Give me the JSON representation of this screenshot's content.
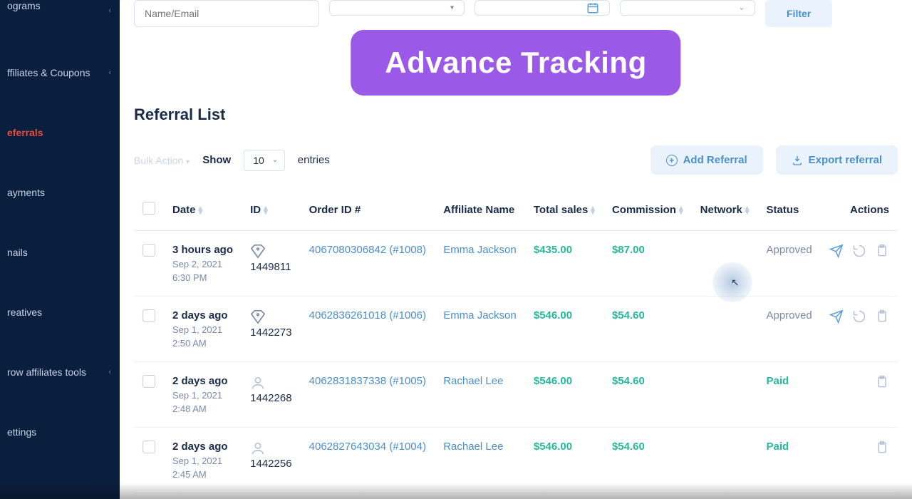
{
  "sidebar": {
    "items": [
      {
        "label": "ograms",
        "has_chevron": true
      },
      {
        "label": "ffiliates & Coupons",
        "has_chevron": true
      },
      {
        "label": "eferrals",
        "active": true
      },
      {
        "label": "ayments"
      },
      {
        "label": "nails"
      },
      {
        "label": "reatives"
      },
      {
        "label": "row affiliates tools",
        "has_chevron": true
      },
      {
        "label": "ettings"
      }
    ]
  },
  "filters": {
    "name_placeholder": "Name/Email",
    "filter_btn": "Filter"
  },
  "overlay": {
    "title": "Advance Tracking"
  },
  "section": {
    "title": "Referral List"
  },
  "toolbar": {
    "bulk_action": "Bulk Action",
    "show_label": "Show",
    "show_value": "10",
    "entries_label": "entries",
    "add_label": "Add Referral",
    "export_label": "Export referral"
  },
  "columns": [
    "Date",
    "ID",
    "Order ID #",
    "Affiliate Name",
    "Total sales",
    "Commission",
    "Network",
    "Status",
    "Actions"
  ],
  "rows": [
    {
      "date_rel": "3 hours ago",
      "date_abs1": "Sep 2, 2021",
      "date_abs2": "6:30 PM",
      "icon": "tag",
      "id": "1449811",
      "order": "4067080306842 (#1008)",
      "affiliate": "Emma Jackson",
      "sales": "$435.00",
      "commission": "$87.00",
      "network": "",
      "status": "Approved",
      "status_class": "approved",
      "actions": [
        "send",
        "undo",
        "clip"
      ]
    },
    {
      "date_rel": "2 days ago",
      "date_abs1": "Sep 1, 2021",
      "date_abs2": "2:50 AM",
      "icon": "tag",
      "id": "1442273",
      "order": "4062836261018 (#1006)",
      "affiliate": "Emma Jackson",
      "sales": "$546.00",
      "commission": "$54.60",
      "network": "",
      "status": "Approved",
      "status_class": "approved",
      "actions": [
        "send",
        "undo",
        "clip"
      ]
    },
    {
      "date_rel": "2 days ago",
      "date_abs1": "Sep 1, 2021",
      "date_abs2": "2:48 AM",
      "icon": "user",
      "id": "1442268",
      "order": "4062831837338 (#1005)",
      "affiliate": "Rachael Lee",
      "sales": "$546.00",
      "commission": "$54.60",
      "network": "",
      "status": "Paid",
      "status_class": "paid",
      "actions": [
        "clip"
      ]
    },
    {
      "date_rel": "2 days ago",
      "date_abs1": "Sep 1, 2021",
      "date_abs2": "2:45 AM",
      "icon": "user",
      "id": "1442256",
      "order": "4062827643034 (#1004)",
      "affiliate": "Rachael Lee",
      "sales": "$546.00",
      "commission": "$54.60",
      "network": "",
      "status": "Paid",
      "status_class": "paid",
      "actions": [
        "clip"
      ]
    }
  ]
}
